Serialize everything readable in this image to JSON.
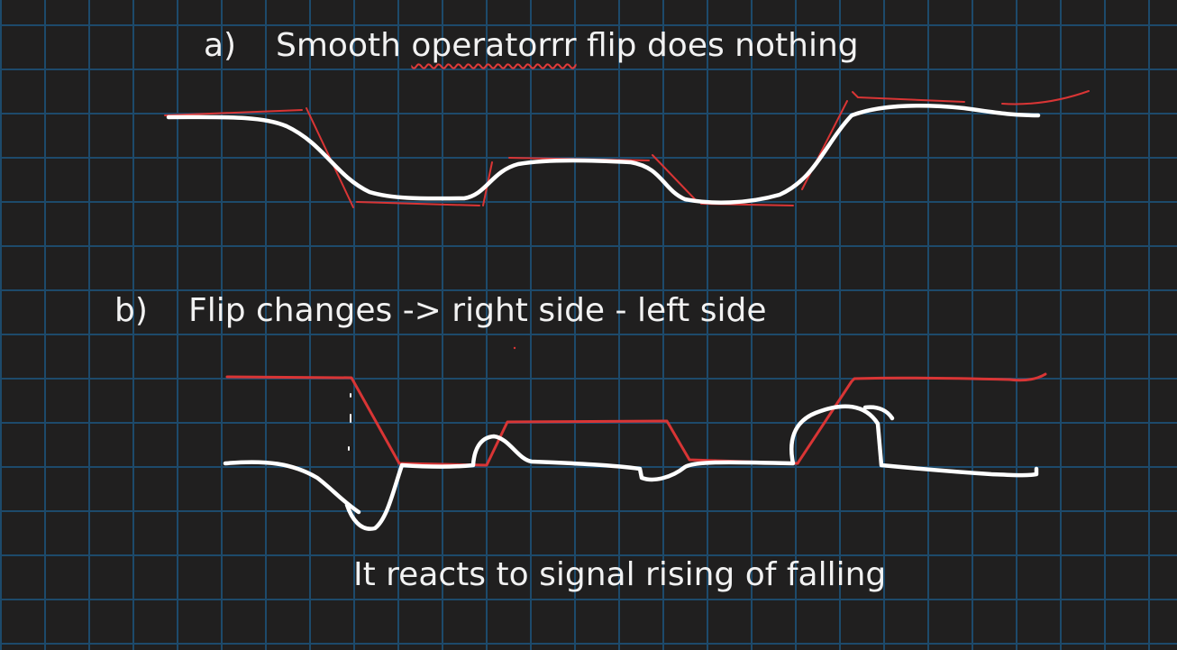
{
  "section_a": {
    "marker": "a)",
    "text_before": "Smooth ",
    "misspelled_word": "operatorrr",
    "text_after": " flip does nothing"
  },
  "section_b": {
    "marker": "b)",
    "text": "Flip changes -> right side - left side"
  },
  "caption": {
    "text": "It reacts to signal rising of falling"
  },
  "colors": {
    "background": "#201f1f",
    "grid": "#1d4a6b",
    "text": "#f2f2f2",
    "ink_white": "#ffffff",
    "ink_red": "#d93535",
    "spellcheck_underline": "#e03a3a"
  }
}
